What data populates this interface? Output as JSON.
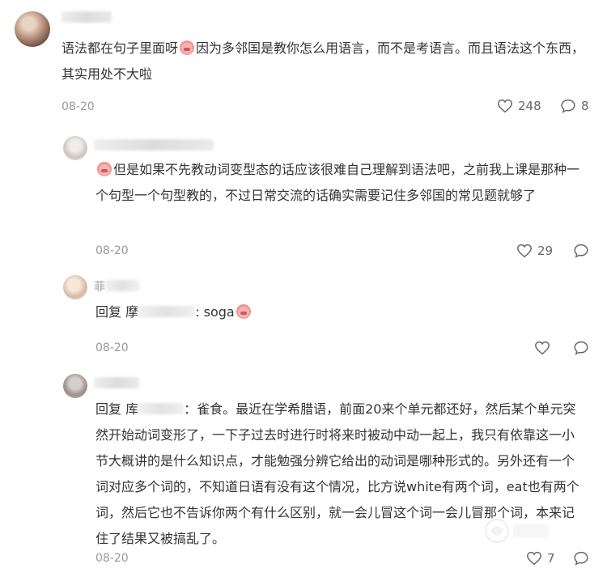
{
  "comments": [
    {
      "text_parts": [
        "语法都在句子里面呀",
        "因为多邻国是教你怎么用语言，而不是考语言。而且语法这个东西，其实用处不大啦"
      ],
      "date": "08-20",
      "like_count": "248",
      "reply_count": "8",
      "replies": [
        {
          "text_parts": [
            "但是如果不先教动词变型态的话应该很难自己理解到语法吧，之前我上课是那种一个句型一个句型教的，不过日常交流的话确实需要记住多邻国的常见题就够了"
          ],
          "date": "08-20",
          "like_count": "29"
        },
        {
          "name_partial": "菲",
          "reply_prefix": "回复",
          "reply_target_partial": "摩",
          "reply_text": ": soga",
          "date": "08-20"
        },
        {
          "reply_prefix": "回复",
          "reply_target_partial": "库",
          "reply_text": "：雀食。最近在学希腊语，前面20来个单元都还好，然后某个单元突然开始动词变形了，一下子过去时进行时将来时被动中动一起上，我只有依靠这一小节大概讲的是什么知识点，才能勉强分辨它给出的动词是哪种形式的。另外还有一个词对应多个词的，不知道日语有没有这个情况，比方说white有两个词，eat也有两个词，然后它也不告诉你两个有什么区别，就一会儿冒这个词一会儿冒那个词，本来记住了结果又被搞乱了。",
          "date": "08-20",
          "like_count": "7"
        }
      ]
    }
  ],
  "icons": {
    "like": "heart-outline-icon",
    "reply": "speech-bubble-icon",
    "emoji": "pig-face-emoji-icon"
  },
  "colors": {
    "text": "#333333",
    "meta": "#999999"
  }
}
